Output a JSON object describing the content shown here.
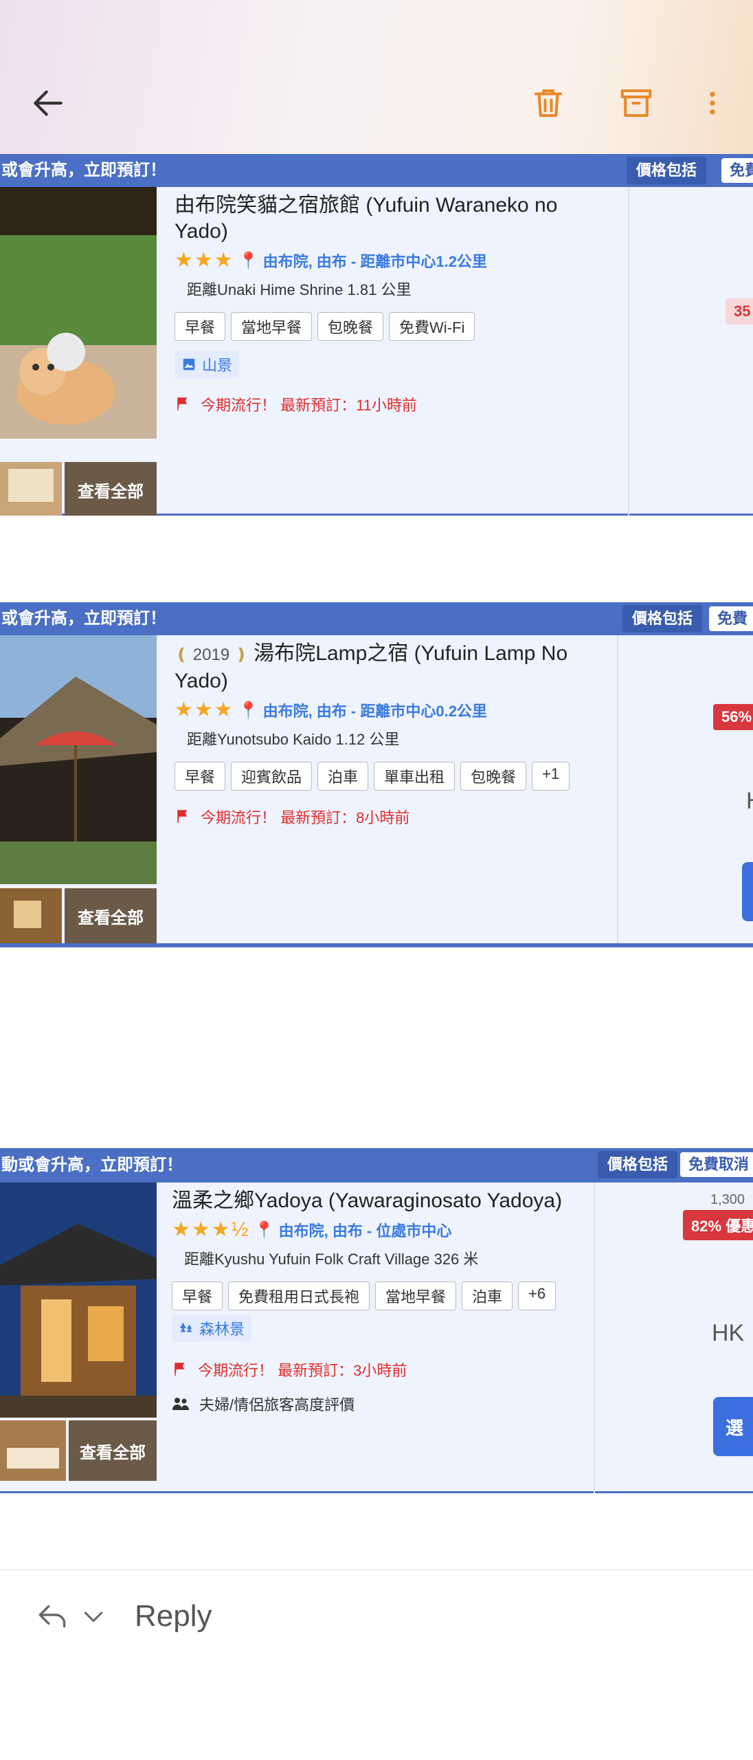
{
  "toolbar": {
    "back_icon": "back-arrow-icon",
    "delete_icon": "trash-icon",
    "archive_icon": "archive-icon",
    "more_icon": "more-vert-icon",
    "accent": "#e8892b"
  },
  "hotels": [
    {
      "banner_text": "或會升高，立即預訂！",
      "chip_price": "價格包括",
      "chip_free": "免費",
      "title": "由布院笑貓之宿旅館 (Yufuin Waraneko no Yado)",
      "award": "",
      "stars": "★★★",
      "location": "由布院, 由布 - 距離市中心1.2公里",
      "distance": "距離Unaki Hime Shrine 1.81 公里",
      "tags": [
        "早餐",
        "當地早餐",
        "包晚餐",
        "免費Wi-Fi"
      ],
      "extra": "山景",
      "trend": "今期流行！ 最新預訂：11小時前",
      "review": "",
      "view_all": "查看全部",
      "price_badge": "35",
      "price_hk": "",
      "price_strike": "",
      "select_label": ""
    },
    {
      "banner_text": "或會升高，立即預訂！",
      "chip_price": "價格包括",
      "chip_free": "免費",
      "title": "湯布院Lamp之宿 (Yufuin Lamp No Yado)",
      "award": "2019",
      "stars": "★★★",
      "location": "由布院, 由布 - 距離市中心0.2公里",
      "distance": "距離Yunotsubo Kaido 1.12 公里",
      "tags": [
        "早餐",
        "迎賓飲品",
        "泊車",
        "單車出租",
        "包晚餐",
        "+1"
      ],
      "extra": "",
      "trend": "今期流行！ 最新預訂：8小時前",
      "review": "",
      "view_all": "查看全部",
      "price_badge": "56%",
      "price_hk": "H",
      "price_strike": "",
      "select_label": ""
    },
    {
      "banner_text": "動或會升高，立即預訂！",
      "chip_price": "價格包括",
      "chip_free": "免費取消",
      "title": "溫柔之鄉Yadoya (Yawaraginosato Yadoya)",
      "award": "",
      "stars": "★★★½",
      "location": "由布院, 由布 - 位處市中心",
      "distance": "距離Kyushu Yufuin Folk Craft Village 326 米",
      "tags": [
        "早餐",
        "免費租用日式長袍",
        "當地早餐",
        "泊車",
        "+6"
      ],
      "extra": "森林景",
      "trend": "今期流行！ 最新預訂：3小時前",
      "review": "夫婦/情侶旅客高度評價",
      "view_all": "查看全部",
      "price_badge": "82% 優惠",
      "price_hk": "HK",
      "price_strike": "1,300",
      "select_label": "選"
    }
  ],
  "reply": {
    "label": "Reply",
    "reply_icon": "reply-icon",
    "chevron_icon": "chevron-down-icon"
  }
}
